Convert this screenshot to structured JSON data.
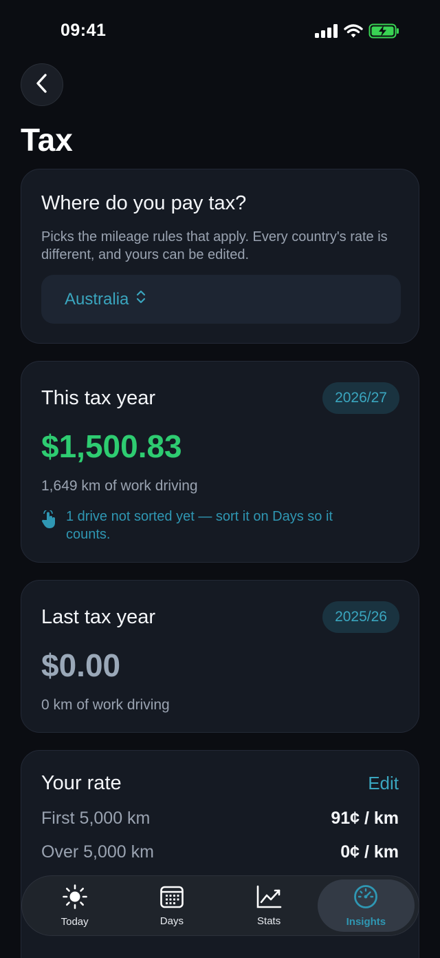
{
  "status_bar": {
    "time": "09:41",
    "icons": [
      "signal-icon",
      "wifi-icon",
      "battery-charging-icon"
    ]
  },
  "nav": {
    "back_icon": "chevron-left-icon"
  },
  "page": {
    "title": "Tax"
  },
  "country_card": {
    "title": "Where do you pay tax?",
    "description": "Picks the mileage rules that apply. Every country's rate is different, and yours can be edited.",
    "selected_country": "Australia",
    "selector_icon": "chevron-up-down-icon"
  },
  "this_year": {
    "title": "This tax year",
    "period": "2026/27",
    "amount": "$1,500.83",
    "distance": "1,649 km of work driving",
    "unsorted_notice": "1 drive not sorted yet — sort it on Days so it counts.",
    "unsorted_icon": "hand-tap-icon"
  },
  "last_year": {
    "title": "Last tax year",
    "period": "2025/26",
    "amount": "$0.00",
    "distance": "0 km of work driving"
  },
  "rate": {
    "title": "Your rate",
    "edit_label": "Edit",
    "rows": [
      {
        "label": "First 5,000 km",
        "value": "91¢ / km"
      },
      {
        "label": "Over 5,000 km",
        "value": "0¢ / km"
      }
    ]
  },
  "tabbar": {
    "tabs": [
      {
        "label": "Today",
        "icon": "sun-icon",
        "active": false
      },
      {
        "label": "Days",
        "icon": "calendar-icon",
        "active": false
      },
      {
        "label": "Stats",
        "icon": "line-chart-icon",
        "active": false
      },
      {
        "label": "Insights",
        "icon": "speedometer-icon",
        "active": true
      }
    ]
  },
  "colors": {
    "background": "#0b0d12",
    "card": "#151a23",
    "accent": "#3aa6bf",
    "positive": "#2ecc71",
    "muted": "#9aa3b1"
  }
}
